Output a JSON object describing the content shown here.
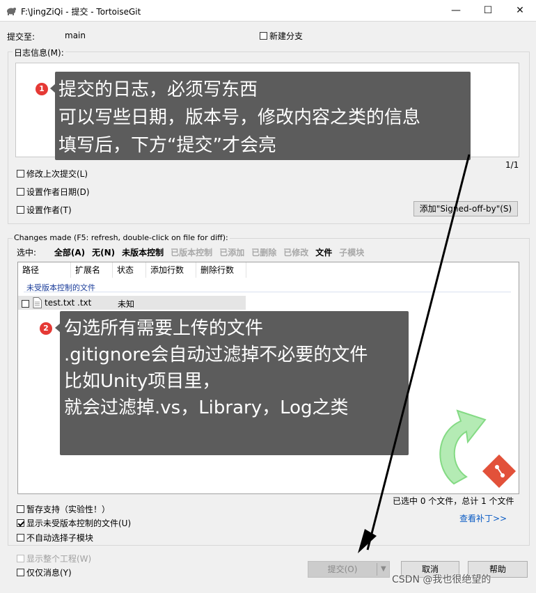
{
  "window": {
    "title": "F:\\JingZiQi - 提交 - TortoiseGit",
    "minimize": "—",
    "maximize": "☐",
    "close": "✕"
  },
  "commit_to": {
    "label": "提交至:",
    "branch": "main",
    "new_branch_label": "新建分支"
  },
  "log_group": {
    "label": "日志信息(M):",
    "counter": "1/1"
  },
  "log_options": {
    "amend": "修改上次提交(L)",
    "set_date": "设置作者日期(D)",
    "set_author": "设置作者(T)",
    "signed_off_button": "添加\"Signed-off-by\"(S)"
  },
  "changes": {
    "label": "Changes made (F5: refresh, double-click on file for diff):",
    "select_label": "选中:",
    "filters": [
      {
        "label": "全部(A)",
        "enabled": true
      },
      {
        "label": "无(N)",
        "enabled": true
      },
      {
        "label": "未版本控制",
        "enabled": true
      },
      {
        "label": "已版本控制",
        "enabled": false
      },
      {
        "label": "已添加",
        "enabled": false
      },
      {
        "label": "已删除",
        "enabled": false
      },
      {
        "label": "已修改",
        "enabled": false
      },
      {
        "label": "文件",
        "enabled": true
      },
      {
        "label": "子模块",
        "enabled": false
      }
    ],
    "columns": [
      "路径",
      "扩展名",
      "状态",
      "添加行数",
      "删除行数"
    ],
    "group_header": "未受版本控制的文件",
    "rows": [
      {
        "path": "test.txt",
        "ext": ".txt",
        "status": "未知",
        "checked": false
      }
    ],
    "summary": "已选中 0 个文件，总计 1 个文件",
    "patch_link": "查看补丁>>"
  },
  "bottom_options": {
    "stash": "暂存支持（实验性！）",
    "show_unversioned": "显示未受版本控制的文件(U)",
    "no_auto_submodule": "不自动选择子模块",
    "whole_project": "显示整个工程(W)",
    "message_only": "仅仅消息(Y)"
  },
  "buttons": {
    "commit": "提交(O)",
    "cancel": "取消",
    "help": "帮助"
  },
  "annotation1": {
    "number": "1",
    "lines": [
      "提交的日志，必须写东西",
      "可以写些日期，版本号，修改内容之类的信息",
      "填写后，下方“提交”才会亮"
    ]
  },
  "annotation2": {
    "number": "2",
    "lines": [
      "勾选所有需要上传的文件",
      ".gitignore会自动过滤掉不必要的文件",
      "比如Unity项目里，",
      "就会过滤掉.vs，Library，Log之类"
    ]
  },
  "watermark": "CSDN @我也很绝望的",
  "colors": {
    "annotation_bg": "#5c5c5c",
    "badge": "#e53935",
    "link": "#0a5bc4",
    "logo_green": "#6fd46f",
    "logo_red": "#e2513a"
  }
}
